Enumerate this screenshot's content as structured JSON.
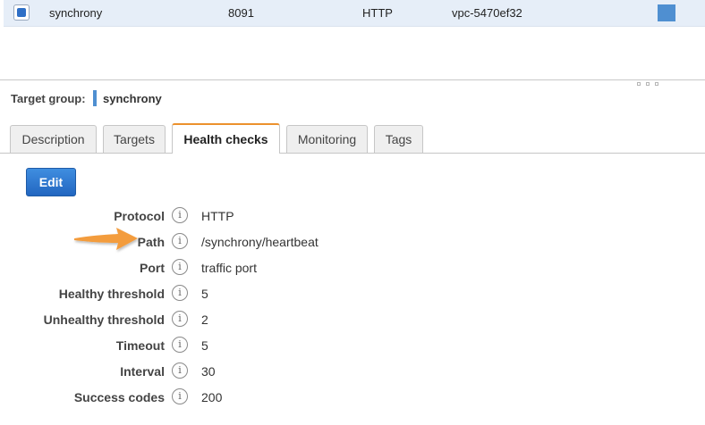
{
  "table_row": {
    "name": "synchrony",
    "port": "8091",
    "protocol": "HTTP",
    "vpc": "vpc-5470ef32"
  },
  "target_group": {
    "label": "Target group:",
    "name": "synchrony"
  },
  "tabs": [
    {
      "label": "Description"
    },
    {
      "label": "Targets"
    },
    {
      "label": "Health checks",
      "active": true
    },
    {
      "label": "Monitoring"
    },
    {
      "label": "Tags"
    }
  ],
  "edit_label": "Edit",
  "health_checks": [
    {
      "label": "Protocol",
      "value": "HTTP"
    },
    {
      "label": "Path",
      "value": "/synchrony/heartbeat"
    },
    {
      "label": "Port",
      "value": "traffic port"
    },
    {
      "label": "Healthy threshold",
      "value": "5"
    },
    {
      "label": "Unhealthy threshold",
      "value": "2"
    },
    {
      "label": "Timeout",
      "value": "5"
    },
    {
      "label": "Interval",
      "value": "30"
    },
    {
      "label": "Success codes",
      "value": "200"
    }
  ],
  "icons": {
    "info": "info-icon",
    "arrow": "arrow-annotation-icon"
  },
  "colors": {
    "accent": "#2e6fc6",
    "active_tab_border": "#ec912d",
    "arrow": "#f39c3c",
    "row_selected": "#e6eef8"
  }
}
